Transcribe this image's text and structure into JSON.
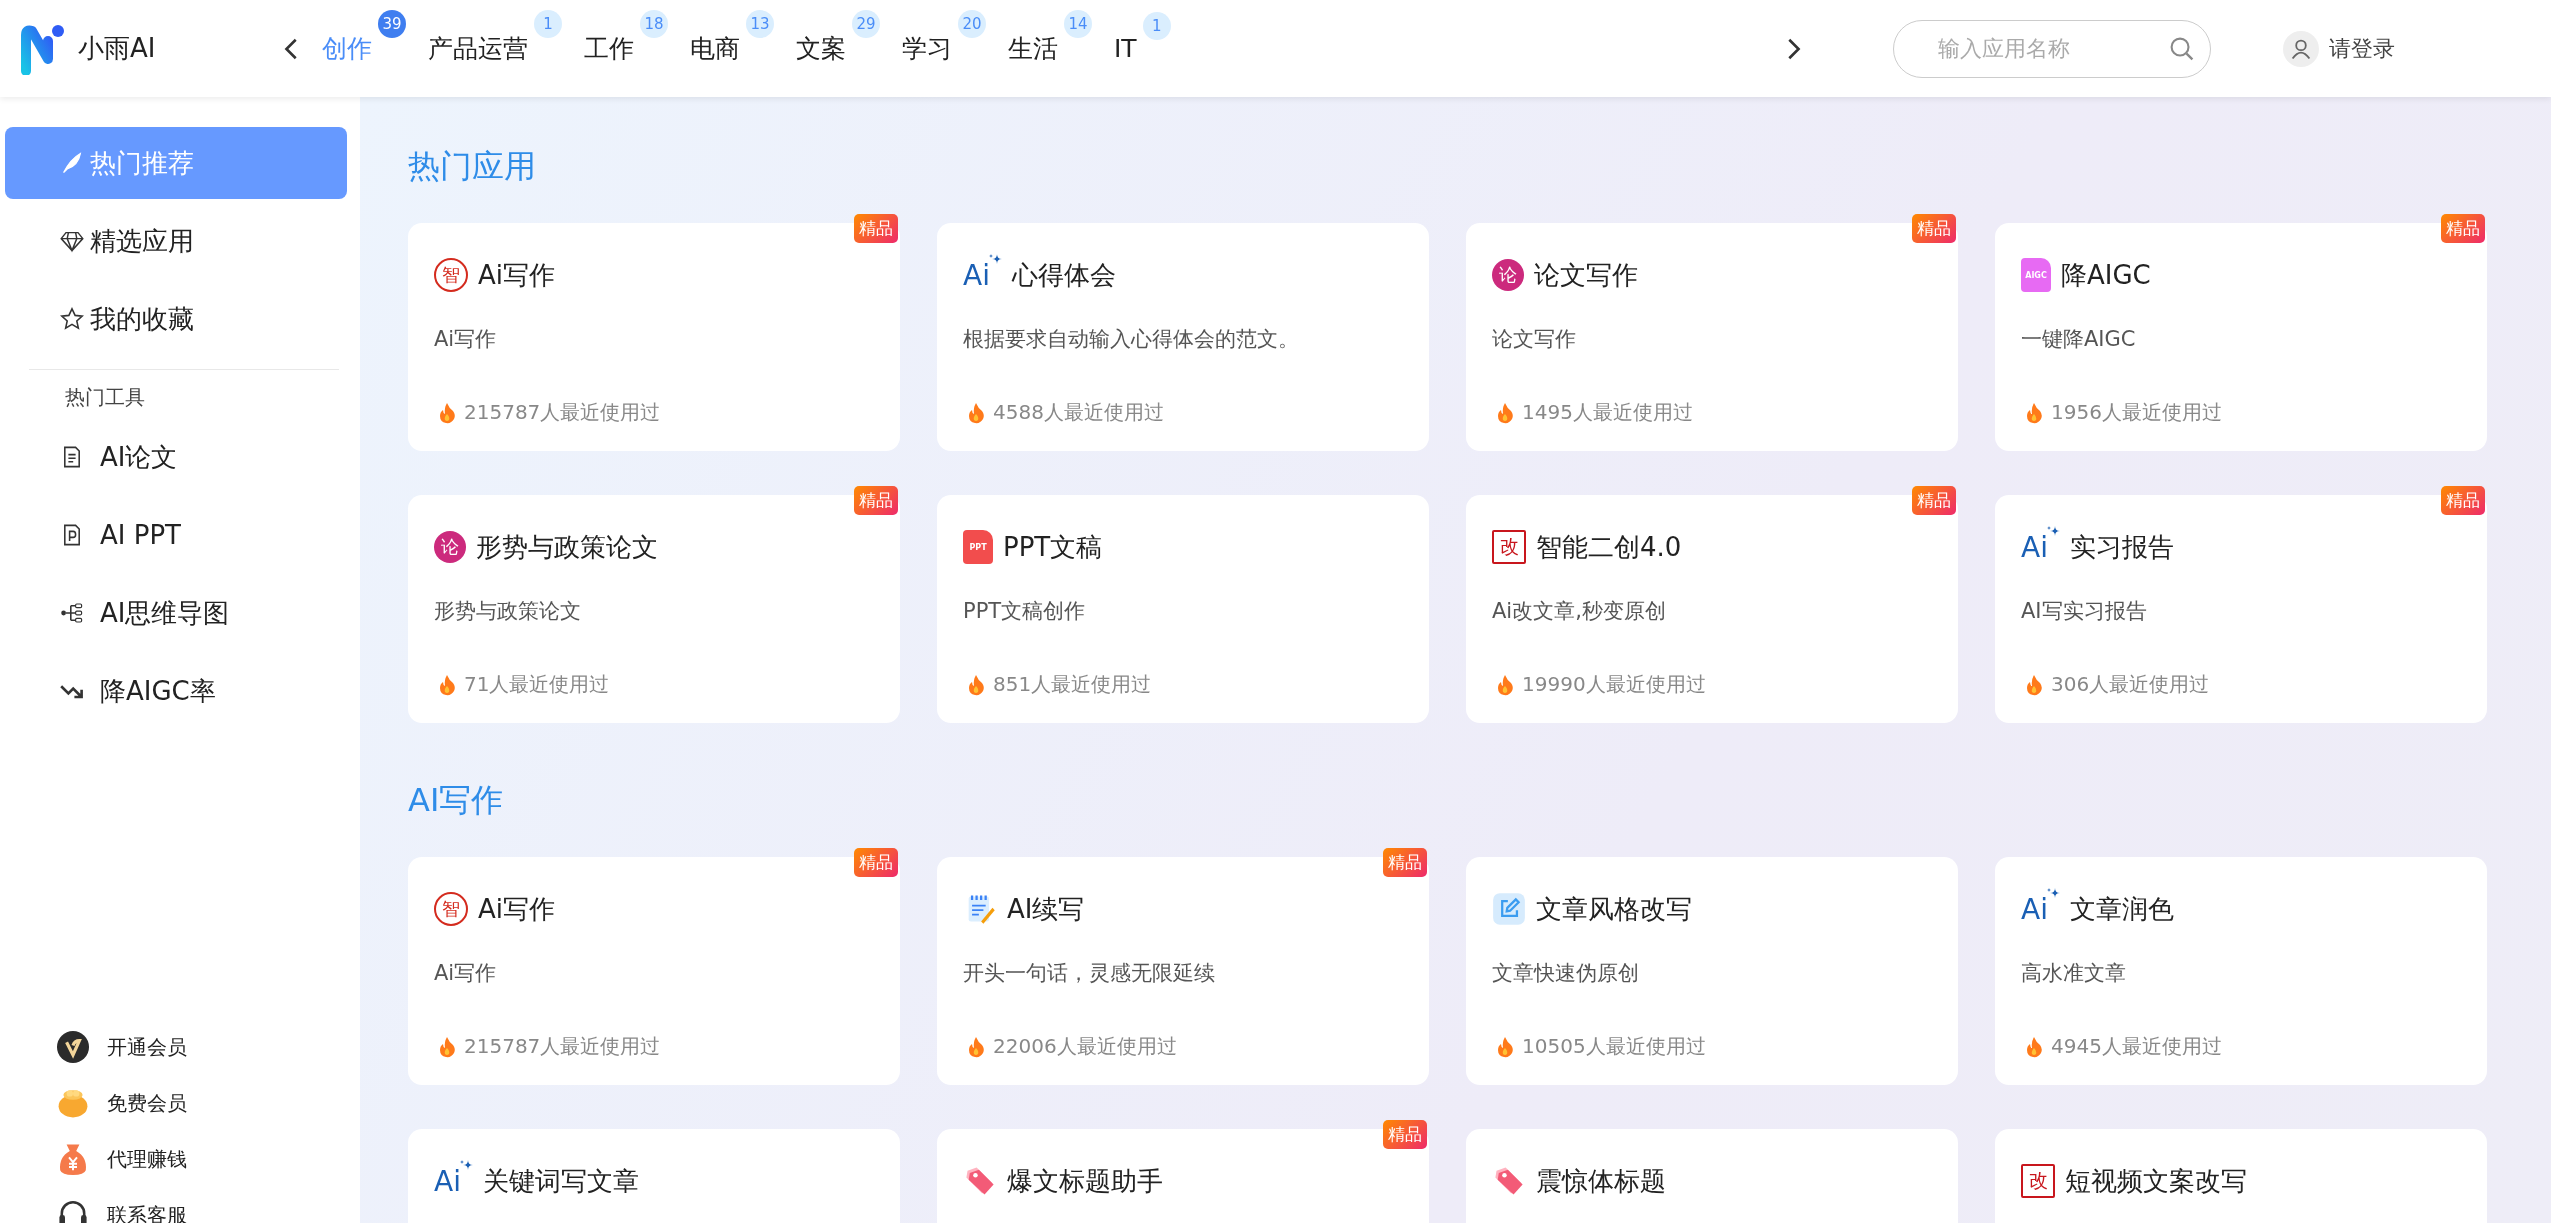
{
  "brand": {
    "name": "小雨AI"
  },
  "nav": {
    "tabs": [
      {
        "label": "创作",
        "count": "39",
        "selected": true
      },
      {
        "label": "产品运营",
        "count": "1",
        "selected": false
      },
      {
        "label": "工作",
        "count": "18",
        "selected": false
      },
      {
        "label": "电商",
        "count": "13",
        "selected": false
      },
      {
        "label": "文案",
        "count": "29",
        "selected": false
      },
      {
        "label": "学习",
        "count": "20",
        "selected": false
      },
      {
        "label": "生活",
        "count": "14",
        "selected": false
      },
      {
        "label": "IT",
        "count": "1",
        "selected": false
      }
    ]
  },
  "search": {
    "placeholder": "输入应用名称"
  },
  "user": {
    "login": "请登录"
  },
  "sidebar": {
    "items": [
      {
        "label": "热门推荐",
        "selected": true
      },
      {
        "label": "精选应用",
        "selected": false
      },
      {
        "label": "我的收藏",
        "selected": false
      }
    ],
    "tools_heading": "热门工具",
    "tools": [
      {
        "label": "AI论文",
        "selected": false
      },
      {
        "label": "AI PPT",
        "selected": false
      },
      {
        "label": "AI思维导图",
        "selected": false
      },
      {
        "label": "降AIGC率",
        "selected": false
      }
    ],
    "footer_links": [
      {
        "label": "开通会员"
      },
      {
        "label": "免费会员"
      },
      {
        "label": "代理赚钱"
      },
      {
        "label": "联系客服"
      }
    ]
  },
  "sections": [
    {
      "title": "热门应用",
      "cards": [
        {
          "title": "Ai写作",
          "kind": "seal",
          "glyph": "智",
          "description": "Ai写作",
          "usage": "215787人最近使用过",
          "badge": "精品"
        },
        {
          "title": "心得体会",
          "kind": "ai",
          "glyph": "Ai",
          "description": "根据要求自动输入心得体会的范文。",
          "usage": "4588人最近使用过"
        },
        {
          "title": "论文写作",
          "kind": "disc",
          "glyph": "论",
          "description": "论文写作",
          "usage": "1495人最近使用过",
          "badge": "精品"
        },
        {
          "title": "降AIGC",
          "kind": "aigc",
          "glyph": "AIGC",
          "description": "一键降AIGC",
          "usage": "1956人最近使用过",
          "badge": "精品"
        },
        {
          "title": "形势与政策论文",
          "kind": "disc",
          "glyph": "论",
          "description": "形势与政策论文",
          "usage": "71人最近使用过",
          "badge": "精品"
        },
        {
          "title": "PPT文稿",
          "kind": "ppt",
          "glyph": "PPT",
          "description": "PPT文稿创作",
          "usage": "851人最近使用过"
        },
        {
          "title": "智能二创4.0",
          "kind": "stamp",
          "glyph": "改",
          "description": "Ai改文章,秒变原创",
          "usage": "19990人最近使用过",
          "badge": "精品"
        },
        {
          "title": "实习报告",
          "kind": "ai",
          "glyph": "Ai",
          "description": "AI写实习报告",
          "usage": "306人最近使用过",
          "badge": "精品"
        }
      ]
    },
    {
      "title": "AI写作",
      "cards": [
        {
          "title": "Ai写作",
          "kind": "seal",
          "glyph": "智",
          "description": "Ai写作",
          "usage": "215787人最近使用过",
          "badge": "精品"
        },
        {
          "title": "AI续写",
          "kind": "notepad",
          "description": "开头一句话，灵感无限延续",
          "usage": "22006人最近使用过",
          "badge": "精品"
        },
        {
          "title": "文章风格改写",
          "kind": "edit",
          "description": "文章快速伪原创",
          "usage": "10505人最近使用过"
        },
        {
          "title": "文章润色",
          "kind": "ai",
          "glyph": "Ai",
          "description": "高水准文章",
          "usage": "4945人最近使用过"
        },
        {
          "title": "关键词写文章",
          "kind": "ai",
          "glyph": "Ai"
        },
        {
          "title": "爆文标题助手",
          "kind": "tag",
          "badge": "精品"
        },
        {
          "title": "震惊体标题",
          "kind": "tag"
        },
        {
          "title": "短视频文案改写",
          "kind": "stamp",
          "glyph": "改"
        }
      ]
    }
  ]
}
